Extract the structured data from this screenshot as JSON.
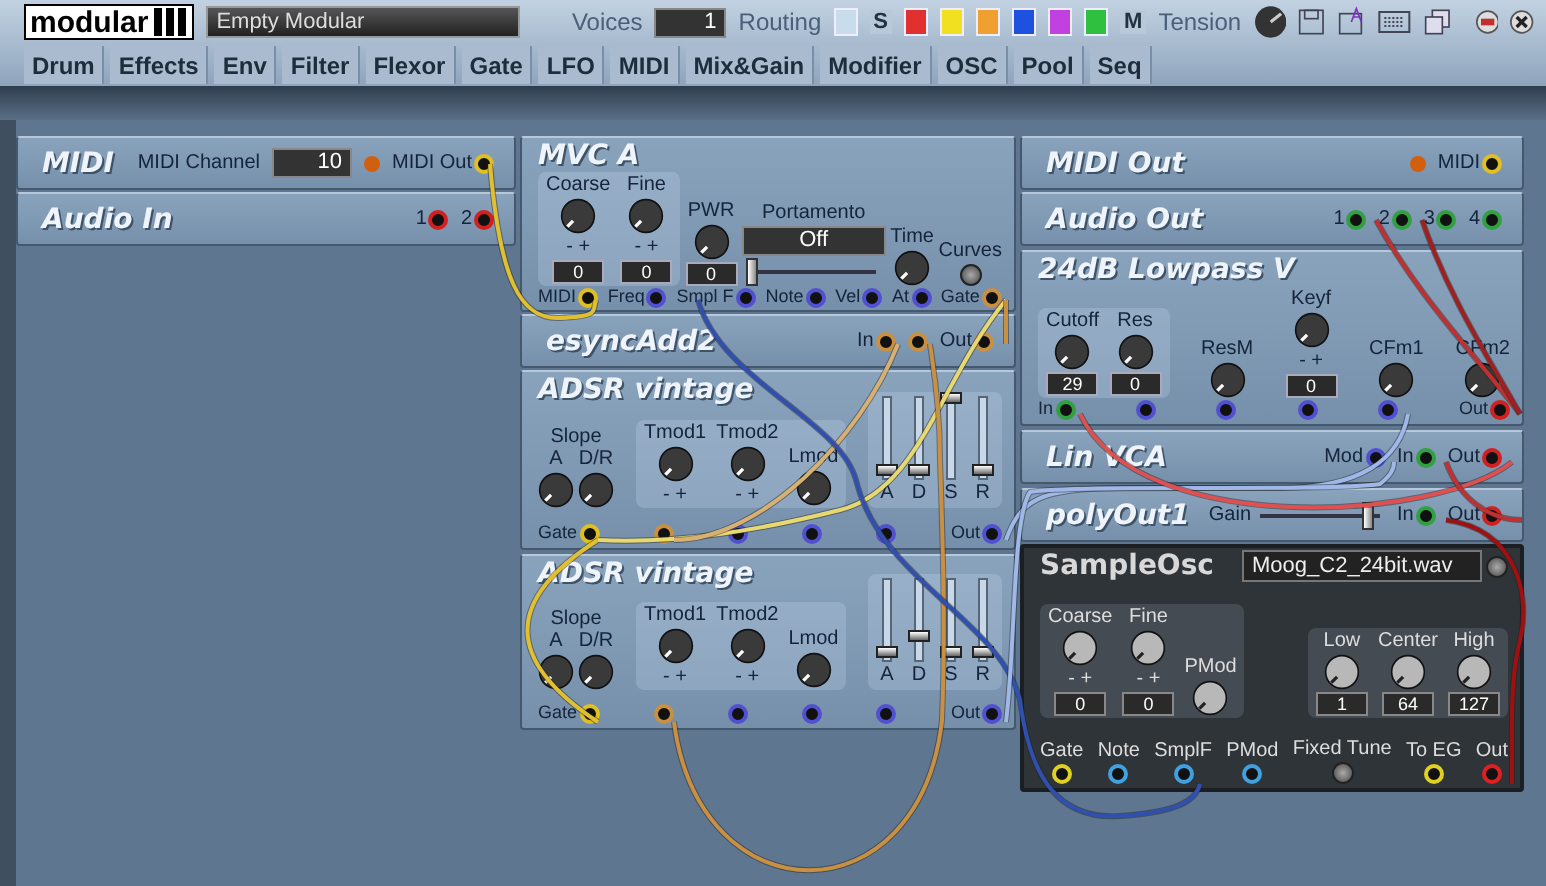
{
  "toolbar": {
    "logo": "modular",
    "patch_name": "Empty Modular",
    "voices_label": "Voices",
    "voices": "1",
    "routing_label": "Routing",
    "routing": [
      {
        "kind": "color",
        "color": "#c8dcec"
      },
      {
        "kind": "letter",
        "text": "S"
      },
      {
        "kind": "color",
        "color": "#e03030"
      },
      {
        "kind": "color",
        "color": "#f0e020"
      },
      {
        "kind": "color",
        "color": "#f0a030"
      },
      {
        "kind": "color",
        "color": "#2050e0"
      },
      {
        "kind": "color",
        "color": "#c040e0"
      },
      {
        "kind": "color",
        "color": "#30c040"
      },
      {
        "kind": "letter",
        "text": "M"
      }
    ],
    "tension_label": "Tension"
  },
  "categories": [
    "Drum",
    "Effects",
    "Env",
    "Filter",
    "Flexor",
    "Gate",
    "LFO",
    "MIDI",
    "Mix&Gain",
    "Modifier",
    "OSC",
    "Pool",
    "Seq"
  ],
  "modules": [
    {
      "kind": "bar",
      "title": "MIDI",
      "items": [
        {
          "kind": "label",
          "text": "MIDI Channel"
        },
        {
          "kind": "display",
          "value": "10"
        },
        {
          "kind": "led",
          "on": true
        },
        {
          "kind": "port",
          "label": "MIDI Out",
          "color": "#e0c020"
        }
      ]
    },
    {
      "kind": "bar",
      "title": "Audio In",
      "items": [
        {
          "kind": "port",
          "label": "1",
          "color": "#d02020"
        },
        {
          "kind": "port",
          "label": "2",
          "color": "#d02020"
        }
      ]
    },
    {
      "kind": "panel",
      "title": "MVC A",
      "controls": [
        {
          "kind": "group",
          "items": [
            {
              "kind": "knob",
              "label": "Coarse",
              "value": "0",
              "signs": "-  +"
            },
            {
              "kind": "knob",
              "label": "Fine",
              "value": "0",
              "signs": "-  +"
            }
          ]
        },
        {
          "kind": "knob",
          "label": "PWR",
          "value": "0"
        },
        {
          "kind": "slider",
          "label": "Portamento",
          "value": "Off",
          "level": 0
        },
        {
          "kind": "knob",
          "label": "Time"
        },
        {
          "kind": "button",
          "label": "Curves"
        }
      ],
      "ports": [
        {
          "label": "MIDI",
          "color": "#e0c020"
        },
        {
          "label": "Freq",
          "color": "#5050d0"
        },
        {
          "label": "Smpl F",
          "color": "#5050d0"
        },
        {
          "label": "Note",
          "color": "#5050d0"
        },
        {
          "label": "Vel",
          "color": "#5050d0"
        },
        {
          "label": "At",
          "color": "#5050d0"
        },
        {
          "label": "Gate",
          "color": "#c89040"
        }
      ]
    },
    {
      "kind": "bar",
      "title": "esyncAdd2",
      "items": [
        {
          "kind": "port",
          "label": "In",
          "color": "#c89040"
        },
        {
          "kind": "port",
          "color": "#c89040"
        },
        {
          "kind": "port",
          "label": "Out",
          "color": "#c89040"
        }
      ]
    },
    {
      "kind": "panel",
      "title": "ADSR vintage",
      "controls": [
        {
          "kind": "cluster",
          "caption": "Slope",
          "items": [
            {
              "kind": "knob",
              "label": "A"
            },
            {
              "kind": "knob",
              "label": "D/R"
            }
          ]
        },
        {
          "kind": "group",
          "items": [
            {
              "kind": "knob",
              "label": "Tmod1",
              "signs": "-  +"
            },
            {
              "kind": "knob",
              "label": "Tmod2",
              "signs": "-  +"
            },
            {
              "kind": "knob",
              "label": "Lmod"
            }
          ]
        },
        {
          "kind": "faders",
          "items": [
            {
              "label": "A",
              "level": 0.1
            },
            {
              "label": "D",
              "level": 0.1
            },
            {
              "label": "S",
              "level": 1
            },
            {
              "label": "R",
              "level": 0.1
            }
          ]
        }
      ],
      "ports": [
        {
          "label": "Gate",
          "color": "#e0c020"
        },
        {
          "color": "#c89040"
        },
        {
          "color": "#5050d0"
        },
        {
          "color": "#5050d0"
        },
        {
          "color": "#5050d0"
        },
        {
          "label": "Out",
          "color": "#5050d0"
        }
      ]
    },
    {
      "kind": "panel",
      "title": "ADSR vintage",
      "controls": [
        {
          "kind": "cluster",
          "caption": "Slope",
          "items": [
            {
              "kind": "knob",
              "label": "A"
            },
            {
              "kind": "knob",
              "label": "D/R"
            }
          ]
        },
        {
          "kind": "group",
          "items": [
            {
              "kind": "knob",
              "label": "Tmod1",
              "signs": "-  +"
            },
            {
              "kind": "knob",
              "label": "Tmod2",
              "signs": "-  +"
            },
            {
              "kind": "knob",
              "label": "Lmod"
            }
          ]
        },
        {
          "kind": "faders",
          "items": [
            {
              "label": "A",
              "level": 0.1
            },
            {
              "label": "D",
              "level": 0.3
            },
            {
              "label": "S",
              "level": 0.1
            },
            {
              "label": "R",
              "level": 0.1
            }
          ]
        }
      ],
      "ports": [
        {
          "label": "Gate",
          "color": "#e0c020"
        },
        {
          "color": "#c89040"
        },
        {
          "color": "#5050d0"
        },
        {
          "color": "#5050d0"
        },
        {
          "color": "#5050d0"
        },
        {
          "label": "Out",
          "color": "#5050d0"
        }
      ]
    },
    {
      "kind": "bar",
      "title": "MIDI Out",
      "items": [
        {
          "kind": "led",
          "on": true
        },
        {
          "kind": "port",
          "label": "MIDI",
          "color": "#e0c020"
        }
      ]
    },
    {
      "kind": "bar",
      "title": "Audio Out",
      "items": [
        {
          "kind": "port",
          "label": "1",
          "color": "#30a040"
        },
        {
          "kind": "port",
          "label": "2",
          "color": "#30a040"
        },
        {
          "kind": "port",
          "label": "3",
          "color": "#30a040"
        },
        {
          "kind": "port",
          "label": "4",
          "color": "#30a040"
        }
      ]
    },
    {
      "kind": "panel",
      "title": "24dB Lowpass V",
      "controls": [
        {
          "kind": "group",
          "items": [
            {
              "kind": "knob",
              "label": "Cutoff",
              "value": "29"
            },
            {
              "kind": "knob",
              "label": "Res",
              "value": "0"
            }
          ]
        },
        {
          "kind": "knob",
          "label": "ResM"
        },
        {
          "kind": "knob",
          "label": "Keyf",
          "value": "0",
          "signs": "-  +"
        },
        {
          "kind": "knob",
          "label": "CFm1"
        },
        {
          "kind": "knob",
          "label": "CFm2"
        }
      ],
      "ports": [
        {
          "label": "In",
          "color": "#30a040"
        },
        {
          "color": "#5050d0"
        },
        {
          "color": "#5050d0"
        },
        {
          "color": "#5050d0"
        },
        {
          "color": "#5050d0"
        },
        {
          "label": "Out",
          "color": "#d02020"
        }
      ]
    },
    {
      "kind": "bar",
      "title": "Lin VCA",
      "items": [
        {
          "kind": "port",
          "label": "Mod",
          "color": "#5050d0"
        },
        {
          "kind": "port",
          "label": "In",
          "color": "#30a040"
        },
        {
          "kind": "port",
          "label": "Out",
          "color": "#d02020"
        }
      ]
    },
    {
      "kind": "bar",
      "title": "polyOut1",
      "items": [
        {
          "kind": "slider",
          "label": "Gain",
          "level": 0.9
        },
        {
          "kind": "port",
          "label": "In",
          "color": "#30a040"
        },
        {
          "kind": "port",
          "label": "Out",
          "color": "#d02020"
        }
      ]
    },
    {
      "kind": "dark",
      "title": "SampleOsc",
      "file": "Moog_C2_24bit.wav",
      "controls": [
        {
          "kind": "group",
          "items": [
            {
              "kind": "knob",
              "label": "Coarse",
              "value": "0",
              "signs": "-  +"
            },
            {
              "kind": "knob",
              "label": "Fine",
              "value": "0",
              "signs": "-  +"
            },
            {
              "kind": "knob",
              "label": "PMod"
            }
          ]
        },
        {
          "kind": "group",
          "items": [
            {
              "kind": "knob",
              "label": "Low",
              "value": "1"
            },
            {
              "kind": "knob",
              "label": "Center",
              "value": "64"
            },
            {
              "kind": "knob",
              "label": "High",
              "value": "127"
            }
          ]
        }
      ],
      "ports": [
        {
          "label": "Gate",
          "color": "#e0d020"
        },
        {
          "label": "Note",
          "color": "#40a0e0"
        },
        {
          "label": "SmplF",
          "color": "#40a0e0"
        },
        {
          "label": "PMod",
          "color": "#40a0e0"
        },
        {
          "kind": "button",
          "label": "Fixed Tune"
        },
        {
          "label": "To EG",
          "color": "#e0d020"
        },
        {
          "label": "Out",
          "color": "#e02020"
        }
      ]
    }
  ]
}
